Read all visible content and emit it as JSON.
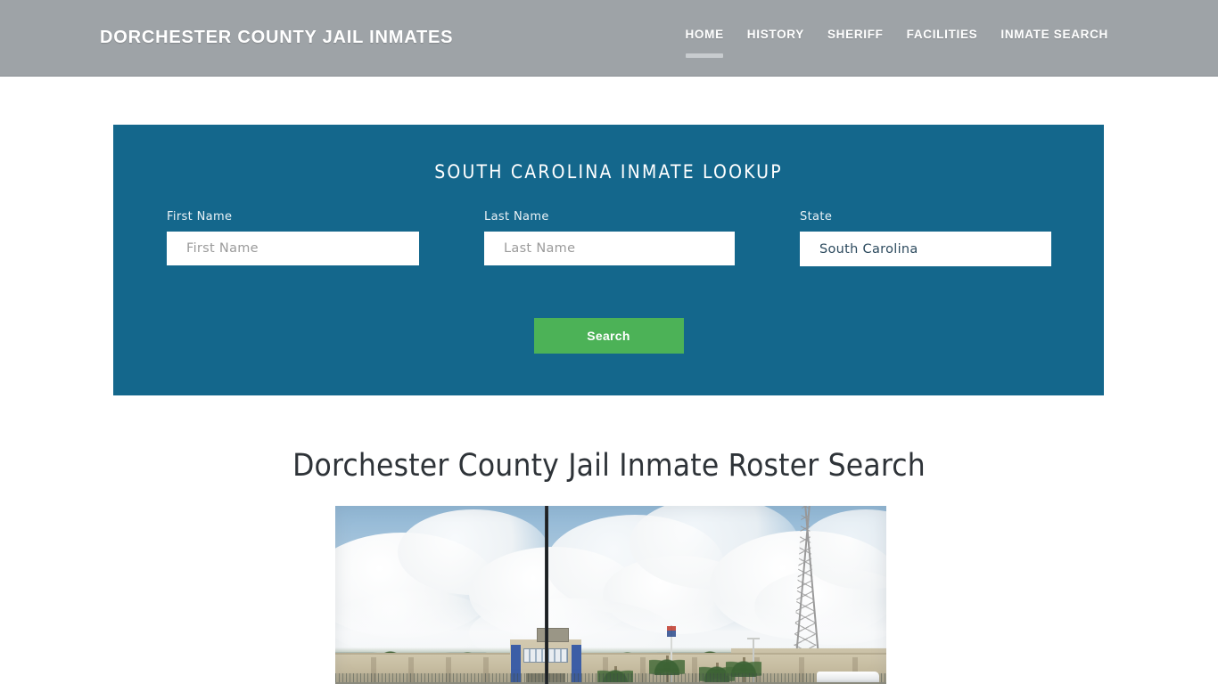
{
  "header": {
    "brand": "DORCHESTER COUNTY JAIL INMATES",
    "brand_color": "#ffffff",
    "background_color": "#9ea3a7",
    "nav": [
      {
        "label": "HOME",
        "active": true
      },
      {
        "label": "HISTORY",
        "active": false
      },
      {
        "label": "SHERIFF",
        "active": false
      },
      {
        "label": "FACILITIES",
        "active": false
      },
      {
        "label": "INMATE SEARCH",
        "active": false
      }
    ]
  },
  "lookup_panel": {
    "title": "SOUTH CAROLINA INMATE LOOKUP",
    "background_color": "#14678c",
    "fields": {
      "first_name": {
        "label": "First Name",
        "placeholder": "First Name",
        "value": ""
      },
      "last_name": {
        "label": "Last Name",
        "placeholder": "Last Name",
        "value": ""
      },
      "state": {
        "label": "State",
        "placeholder": "State",
        "value": "South Carolina"
      }
    },
    "search_button": {
      "label": "Search",
      "color": "#4cb257"
    }
  },
  "main": {
    "heading": "Dorchester County Jail Inmate Roster Search",
    "heading_color": "#2e3338",
    "photo": {
      "alt": "Dorchester County Jail facility exterior with cloudy sky, perimeter wall, flagpole, palm trees and radio tower"
    }
  }
}
